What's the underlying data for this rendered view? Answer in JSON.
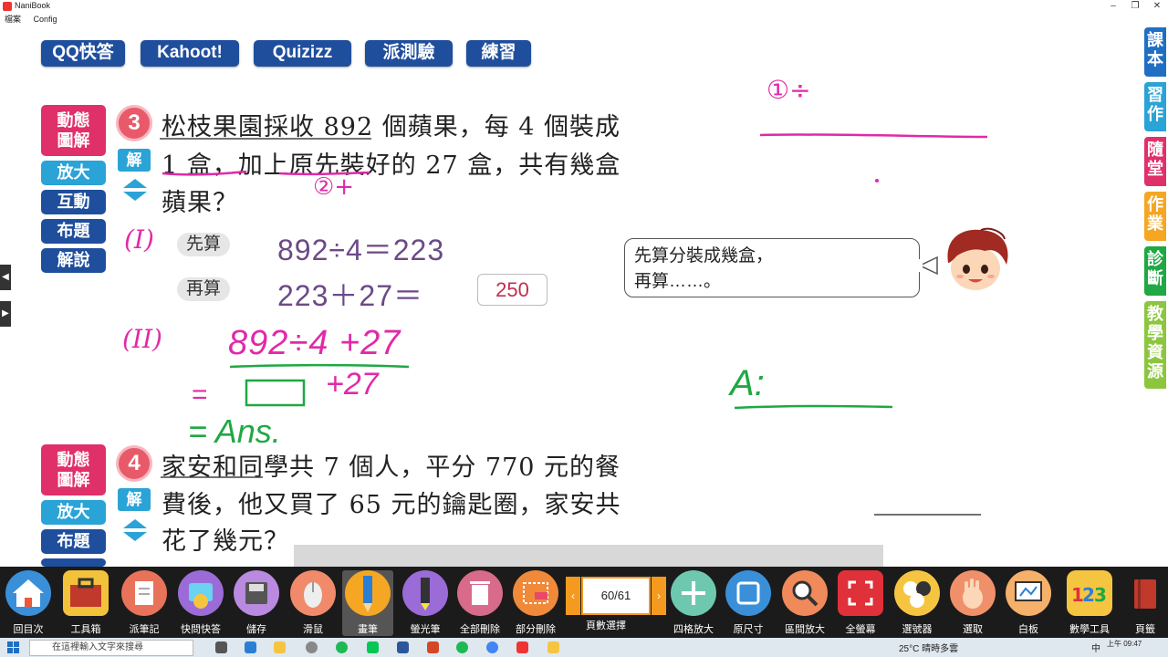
{
  "window": {
    "title": "NaniBook",
    "menu": [
      "檔案",
      "Config"
    ]
  },
  "top_buttons": [
    "QQ快答",
    "Kahoot!",
    "Quizizz",
    "派測驗",
    "練習"
  ],
  "problem3": {
    "number": "3",
    "side_buttons": [
      "動態",
      "圖解",
      "放大",
      "互動",
      "布題",
      "解說"
    ],
    "jie_label": "解",
    "lines": [
      "松枝果園採收 892 個蘋果，每 4 個裝成",
      "1 盒，加上原先裝好的 27 盒，共有幾盒",
      "蘋果？"
    ],
    "step1_label": "先算",
    "step1_eq": "892÷4＝223",
    "step2_label": "再算",
    "step2_eq": "223＋27＝",
    "answer": "250",
    "bubble_line1": "先算分裝成幾盒，",
    "bubble_line2": "再算……。"
  },
  "handwriting": {
    "h1": "①÷",
    "h2": "②+",
    "roman1": "(I)",
    "roman2": "(II)",
    "expr1": "892÷4 +27",
    "eq_sign": "=",
    "expr2": "+27",
    "ans_text": "= Ans.",
    "a_label": "A:"
  },
  "problem4": {
    "number": "4",
    "side_buttons": [
      "動態",
      "圖解",
      "放大",
      "布題"
    ],
    "jie_label": "解",
    "lines": [
      "家安和同學共 7 個人，平分 770 元的餐",
      "費後，他又買了 65 元的鑰匙圈，家安共",
      "花了幾元？"
    ]
  },
  "right_tabs": [
    "課本",
    "習作",
    "隨堂",
    "作業",
    "診斷",
    "教學資源"
  ],
  "toolbar": {
    "left_tools": [
      "回目次",
      "工具箱",
      "派筆記",
      "快問快答",
      "儲存",
      "滑鼠",
      "畫筆",
      "螢光筆",
      "全部刪除",
      "部分刪除"
    ],
    "page_value": "60/61",
    "page_label": "頁數選擇",
    "right_tools": [
      "四格放大",
      "原尺寸",
      "區間放大",
      "全螢幕",
      "選號器",
      "選取",
      "白板"
    ],
    "math_tool": "數學工具",
    "page_tool": "頁籤"
  },
  "taskbar": {
    "search_placeholder": "在這裡輸入文字來搜尋",
    "weather": "25°C 晴時多雲",
    "ime": "中",
    "time": "上午 09:47"
  },
  "colors": {
    "navy": "#1f4e9d",
    "pink": "#e0306a",
    "cyan": "#2aa3d6",
    "marker_pink": "#e02aa8",
    "marker_green": "#1fa843",
    "equation": "#6b4a86"
  }
}
